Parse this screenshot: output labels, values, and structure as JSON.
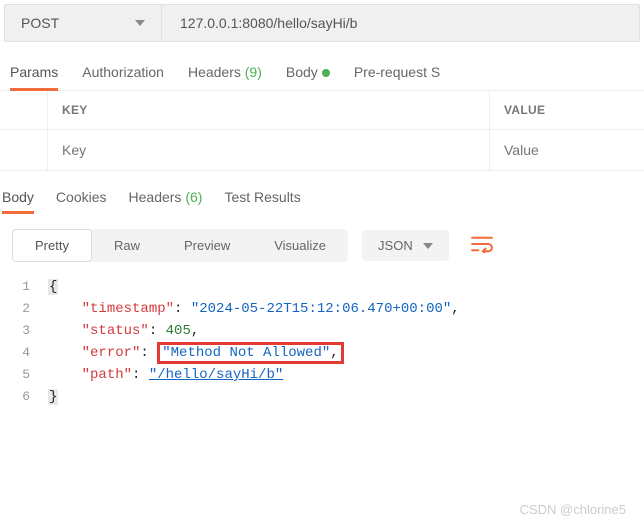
{
  "request": {
    "method": "POST",
    "url": "127.0.0.1:8080/hello/sayHi/b"
  },
  "requestTabs": {
    "params": "Params",
    "authorization": "Authorization",
    "headers": "Headers",
    "headersCount": "(9)",
    "body": "Body",
    "preRequest": "Pre-request S"
  },
  "kv": {
    "keyHeader": "KEY",
    "valueHeader": "VALUE",
    "keyPlaceholder": "Key",
    "valuePlaceholder": "Value"
  },
  "responseTabs": {
    "body": "Body",
    "cookies": "Cookies",
    "headers": "Headers",
    "headersCount": "(6)",
    "testResults": "Test Results"
  },
  "viewControls": {
    "pretty": "Pretty",
    "raw": "Raw",
    "preview": "Preview",
    "visualize": "Visualize",
    "format": "JSON"
  },
  "responseBody": {
    "timestampKey": "\"timestamp\"",
    "timestampVal": "\"2024-05-22T15:12:06.470+00:00\"",
    "statusKey": "\"status\"",
    "statusVal": "405",
    "errorKey": "\"error\"",
    "errorVal": "\"Method Not Allowed\"",
    "pathKey": "\"path\"",
    "pathVal": "\"/hello/sayHi/b\""
  },
  "watermark": "CSDN @chlorine5"
}
